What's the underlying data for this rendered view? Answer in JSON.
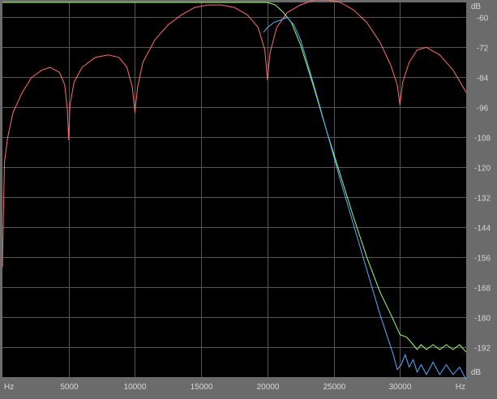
{
  "chart_data": {
    "type": "line",
    "xlabel": "Hz",
    "ylabel": "dB",
    "x_ticks": [
      5000,
      10000,
      15000,
      20000,
      25000,
      30000
    ],
    "y_ticks": [
      -60,
      -72,
      -84,
      -96,
      -108,
      -120,
      -132,
      -144,
      -156,
      -168,
      -180,
      -192
    ],
    "xlim": [
      0,
      35000
    ],
    "ylim": [
      -204,
      -54
    ],
    "grid": true,
    "colors": {
      "background": "#000000",
      "grid": "#555555",
      "frame": "#6b6b6b",
      "red": "#ff6f6f",
      "green": "#9cff6a",
      "blue": "#4fb1ff"
    },
    "series": [
      {
        "color": "#ff6f6f",
        "x": [
          0,
          150,
          400,
          800,
          1500,
          2200,
          3000,
          3600,
          4300,
          4700,
          4900,
          5000,
          5100,
          5400,
          6000,
          7000,
          8000,
          8800,
          9400,
          9800,
          10000,
          10200,
          10600,
          11500,
          12500,
          13500,
          14500,
          15500,
          16500,
          17500,
          18500,
          19300,
          19800,
          20000,
          20200,
          20700,
          21500,
          22500,
          23500,
          24500,
          25500,
          26500,
          27500,
          28500,
          29300,
          29800,
          30000,
          30200,
          30700,
          31300,
          32000,
          33000,
          34000,
          35000
        ],
        "y": [
          -160,
          -118,
          -108,
          -98,
          -90,
          -84,
          -81,
          -80,
          -82,
          -87,
          -97,
          -109,
          -95,
          -86,
          -80,
          -76,
          -75,
          -76,
          -80,
          -88,
          -98,
          -88,
          -78,
          -69,
          -63,
          -59,
          -56,
          -55,
          -55,
          -56,
          -59,
          -64,
          -73,
          -85,
          -74,
          -64,
          -58,
          -55,
          -53,
          -53,
          -54,
          -57,
          -62,
          -70,
          -79,
          -87,
          -95,
          -86,
          -78,
          -73,
          -72,
          -75,
          -81,
          -90
        ]
      },
      {
        "color": "#9cff6a",
        "x": [
          0,
          20000,
          20600,
          21200,
          21800,
          22500,
          23500,
          24500,
          25500,
          26500,
          27500,
          28500,
          29500,
          30000,
          30500,
          31000,
          31300,
          31600,
          32000,
          32500,
          33000,
          33500,
          34000,
          34500,
          35000
        ],
        "y": [
          -54,
          -54,
          -55,
          -58,
          -62,
          -71,
          -88,
          -106,
          -123,
          -140,
          -156,
          -170,
          -181,
          -187,
          -188,
          -191,
          -193,
          -191,
          -193,
          -191,
          -193,
          -191,
          -193,
          -191,
          -194
        ]
      },
      {
        "color": "#4fb1ff",
        "x": [
          19700,
          20000,
          20500,
          21000,
          21500,
          22000,
          22500,
          23500,
          24500,
          25500,
          26500,
          27500,
          28500,
          29500,
          29800,
          30100,
          30400,
          30700,
          31000,
          31300,
          31600,
          32000,
          32500,
          33000,
          33500,
          34000,
          34500,
          35000
        ],
        "y": [
          -66,
          -64,
          -62,
          -61,
          -60,
          -63,
          -69,
          -87,
          -106,
          -125,
          -143,
          -161,
          -179,
          -195,
          -201,
          -199,
          -195,
          -200,
          -197,
          -202,
          -199,
          -203,
          -198,
          -203,
          -199,
          -203,
          -200,
          -205
        ]
      }
    ]
  }
}
